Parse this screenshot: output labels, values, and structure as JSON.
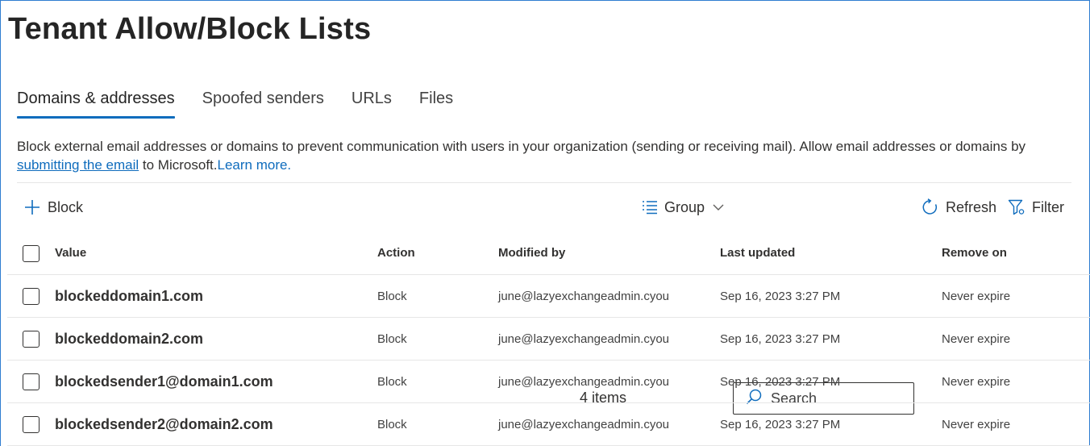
{
  "page": {
    "title": "Tenant Allow/Block Lists"
  },
  "tabs": [
    {
      "label": "Domains & addresses",
      "active": true
    },
    {
      "label": "Spoofed senders",
      "active": false
    },
    {
      "label": "URLs",
      "active": false
    },
    {
      "label": "Files",
      "active": false
    }
  ],
  "description": {
    "text_1": "Block external email addresses or domains to prevent communication with users in your organization (sending or receiving mail). Allow email addresses or domains by ",
    "link_submit": "submitting the email",
    "text_2": " to Microsoft.",
    "link_learn": "Learn more."
  },
  "toolbar": {
    "block_label": "Block",
    "count_label": "4 items",
    "group_label": "Group",
    "search_placeholder": "Search",
    "refresh_label": "Refresh",
    "filter_label": "Filter"
  },
  "table": {
    "columns": [
      "Value",
      "Action",
      "Modified by",
      "Last updated",
      "Remove on"
    ],
    "rows": [
      {
        "value": "blockeddomain1.com",
        "action": "Block",
        "modified_by": "june@lazyexchangeadmin.cyou",
        "last_updated": "Sep 16, 2023 3:27 PM",
        "remove_on": "Never expire"
      },
      {
        "value": "blockeddomain2.com",
        "action": "Block",
        "modified_by": "june@lazyexchangeadmin.cyou",
        "last_updated": "Sep 16, 2023 3:27 PM",
        "remove_on": "Never expire"
      },
      {
        "value": "blockedsender1@domain1.com",
        "action": "Block",
        "modified_by": "june@lazyexchangeadmin.cyou",
        "last_updated": "Sep 16, 2023 3:27 PM",
        "remove_on": "Never expire"
      },
      {
        "value": "blockedsender2@domain2.com",
        "action": "Block",
        "modified_by": "june@lazyexchangeadmin.cyou",
        "last_updated": "Sep 16, 2023 3:27 PM",
        "remove_on": "Never expire"
      }
    ]
  },
  "colors": {
    "accent": "#0f6cbd",
    "frame_border": "#2f7dd0",
    "text": "#242424",
    "divider": "#e6e6e6"
  },
  "icons": {
    "block": "plus-icon",
    "group": "list-icon",
    "group_dropdown": "chevron-down-icon",
    "search": "search-icon",
    "refresh": "refresh-icon",
    "filter": "filter-icon"
  }
}
